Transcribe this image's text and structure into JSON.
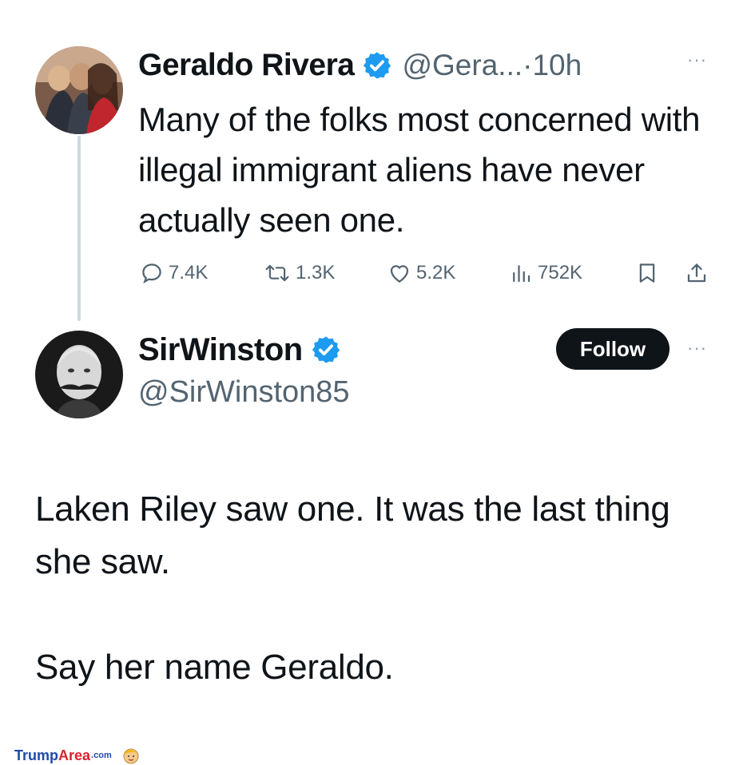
{
  "tweet1": {
    "display_name": "Geraldo Rivera",
    "handle_time": "@Gera...·10h",
    "more": "···",
    "text": "Many of the folks most concerned with illegal immigrant aliens have never actually seen one.",
    "stats": {
      "replies": "7.4K",
      "reposts": "1.3K",
      "likes": "5.2K",
      "views": "752K"
    }
  },
  "tweet2": {
    "display_name": "SirWinston",
    "handle": "@SirWinston85",
    "follow_label": "Follow",
    "more": "···",
    "text_p1": "Laken Riley saw one. It was the last thing she saw.",
    "text_p2": "Say her name Geraldo."
  },
  "watermark": {
    "trump": "Trump",
    "area": "Area",
    "dotcom": ".com"
  },
  "colors": {
    "verified": "#1d9bf0",
    "muted": "#536471",
    "text": "#0f1419"
  }
}
